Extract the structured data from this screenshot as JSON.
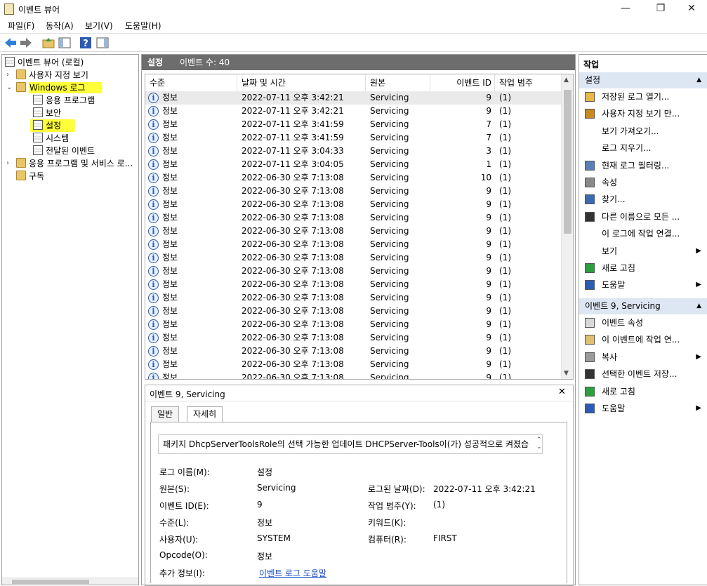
{
  "window": {
    "title": "이벤트 뷰어",
    "controls": [
      "—",
      "❐",
      "✕"
    ]
  },
  "menu": [
    "파일(F)",
    "동작(A)",
    "보기(V)",
    "도움말(H)"
  ],
  "tree": {
    "root": "이벤트 뷰어 (로컬)",
    "custom_views": "사용자 지정 보기",
    "windows_logs": "Windows 로그",
    "app": "응용 프로그램",
    "security": "보안",
    "setup": "설정",
    "system": "시스템",
    "forwarded": "전달된 이벤트",
    "apps_services": "응용 프로그램 및 서비스 로...",
    "subscriptions": "구독"
  },
  "center": {
    "title": "설정",
    "count": "이벤트 수: 40",
    "columns": [
      "수준",
      "날짜 및 시간",
      "원본",
      "이벤트 ID",
      "작업 범주"
    ],
    "rows": [
      [
        "정보",
        "2022-07-11 오후 3:42:21",
        "Servicing",
        "9",
        "(1)"
      ],
      [
        "정보",
        "2022-07-11 오후 3:42:21",
        "Servicing",
        "9",
        "(1)"
      ],
      [
        "정보",
        "2022-07-11 오후 3:41:59",
        "Servicing",
        "7",
        "(1)"
      ],
      [
        "정보",
        "2022-07-11 오후 3:41:59",
        "Servicing",
        "7",
        "(1)"
      ],
      [
        "정보",
        "2022-07-11 오후 3:04:33",
        "Servicing",
        "3",
        "(1)"
      ],
      [
        "정보",
        "2022-07-11 오후 3:04:05",
        "Servicing",
        "1",
        "(1)"
      ],
      [
        "정보",
        "2022-06-30 오후 7:13:08",
        "Servicing",
        "10",
        "(1)"
      ],
      [
        "정보",
        "2022-06-30 오후 7:13:08",
        "Servicing",
        "9",
        "(1)"
      ],
      [
        "정보",
        "2022-06-30 오후 7:13:08",
        "Servicing",
        "9",
        "(1)"
      ],
      [
        "정보",
        "2022-06-30 오후 7:13:08",
        "Servicing",
        "9",
        "(1)"
      ],
      [
        "정보",
        "2022-06-30 오후 7:13:08",
        "Servicing",
        "9",
        "(1)"
      ],
      [
        "정보",
        "2022-06-30 오후 7:13:08",
        "Servicing",
        "9",
        "(1)"
      ],
      [
        "정보",
        "2022-06-30 오후 7:13:08",
        "Servicing",
        "9",
        "(1)"
      ],
      [
        "정보",
        "2022-06-30 오후 7:13:08",
        "Servicing",
        "9",
        "(1)"
      ],
      [
        "정보",
        "2022-06-30 오후 7:13:08",
        "Servicing",
        "9",
        "(1)"
      ],
      [
        "정보",
        "2022-06-30 오후 7:13:08",
        "Servicing",
        "9",
        "(1)"
      ],
      [
        "정보",
        "2022-06-30 오후 7:13:08",
        "Servicing",
        "9",
        "(1)"
      ],
      [
        "정보",
        "2022-06-30 오후 7:13:08",
        "Servicing",
        "9",
        "(1)"
      ],
      [
        "정보",
        "2022-06-30 오후 7:13:08",
        "Servicing",
        "9",
        "(1)"
      ],
      [
        "정보",
        "2022-06-30 오후 7:13:08",
        "Servicing",
        "9",
        "(1)"
      ],
      [
        "정보",
        "2022-06-30 오후 7:13:08",
        "Servicing",
        "9",
        "(1)"
      ],
      [
        "정보",
        "2022-06-30 오후 7:13:08",
        "Servicing",
        "9",
        "(1)"
      ]
    ]
  },
  "detail": {
    "header": "이벤트 9, Servicing",
    "close": "✕",
    "tabs": [
      "일반",
      "자세히"
    ],
    "message": "패키지 DhcpServerToolsRole의 선택 가능한 업데이트 DHCPServer-Tools이(가) 성공적으로 켜졌습",
    "fields": {
      "log_name_label": "로그 이름(M):",
      "log_name": "설정",
      "source_label": "원본(S):",
      "source": "Servicing",
      "logged_label": "로그된 날짜(D):",
      "logged": "2022-07-11 오후 3:42:21",
      "event_id_label": "이벤트 ID(E):",
      "event_id": "9",
      "task_label": "작업 범주(Y):",
      "task": "(1)",
      "level_label": "수준(L):",
      "level": "정보",
      "keywords_label": "키워드(K):",
      "user_label": "사용자(U):",
      "user": "SYSTEM",
      "computer_label": "컴퓨터(R):",
      "computer": "FIRST",
      "opcode_label": "Opcode(O):",
      "opcode": "정보",
      "more_info_label": "추가 정보(I):",
      "more_info": "이벤트 로그 도움말"
    }
  },
  "actions": {
    "title": "작업",
    "section1": "설정",
    "items1": [
      "저장된 로그 열기...",
      "사용자 지정 보기 만...",
      "보기 가져오기...",
      "로그 지우기...",
      "현재 로그 필터링...",
      "속성",
      "찾기...",
      "다른 이름으로 모든 ...",
      "이 로그에 작업 연결...",
      "보기",
      "새로 고침",
      "도움말"
    ],
    "section2": "이벤트 9, Servicing",
    "items2": [
      "이벤트 속성",
      "이 이벤트에 작업 연...",
      "복사",
      "선택한 이벤트 저장...",
      "새로 고침",
      "도움말"
    ]
  },
  "colors": {
    "highlight": "#ffff3a",
    "section_bg": "#dde6f3",
    "header_bg": "#6d6d6d",
    "link": "#1a4fc8"
  }
}
